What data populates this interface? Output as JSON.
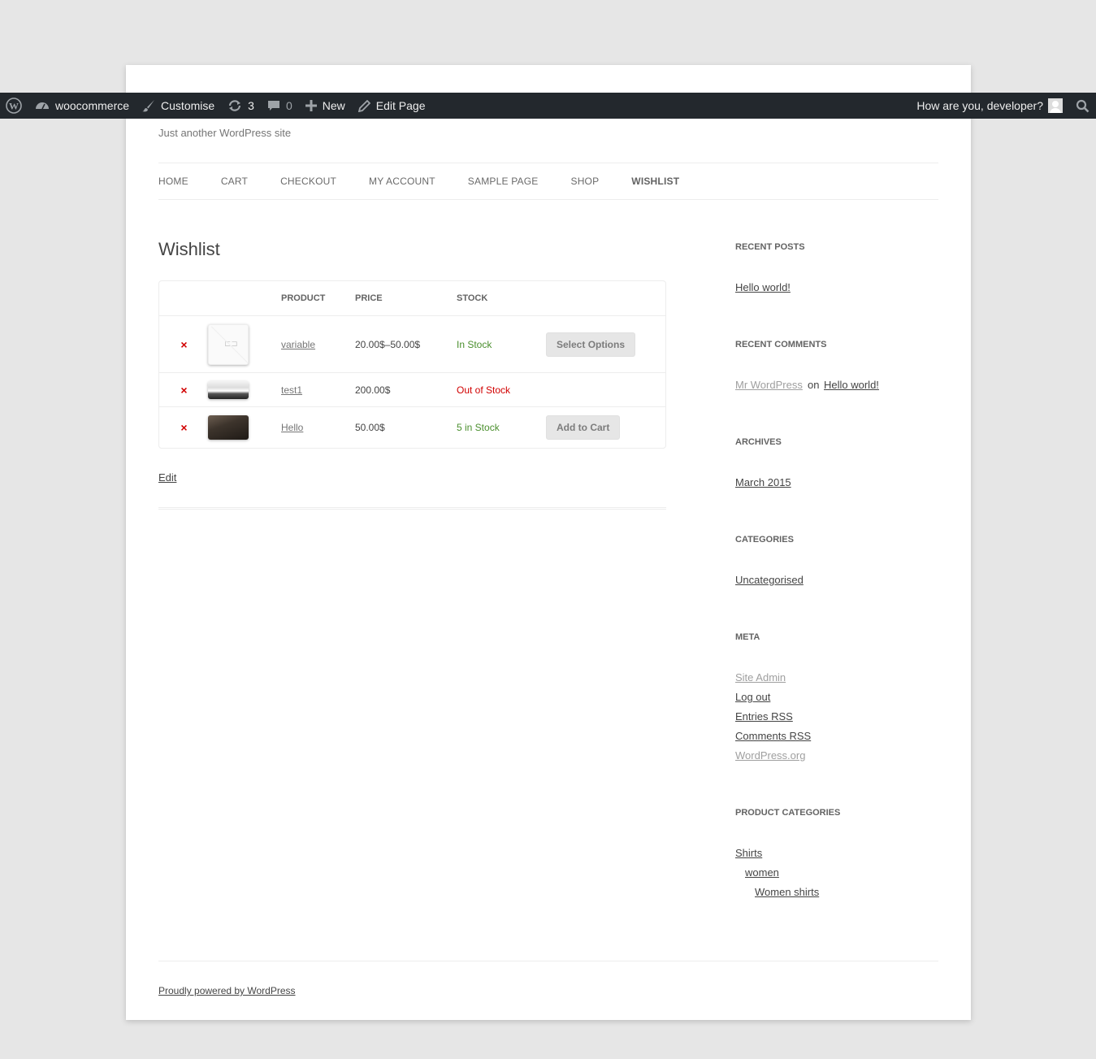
{
  "admin_bar": {
    "site_name": "woocommerce",
    "customise": "Customise",
    "updates_count": "3",
    "comments_count": "0",
    "new_label": "New",
    "edit_page": "Edit Page",
    "greeting": "How are you, developer?"
  },
  "site": {
    "tagline": "Just another WordPress site",
    "nav": [
      "HOME",
      "CART",
      "CHECKOUT",
      "MY ACCOUNT",
      "SAMPLE PAGE",
      "SHOP",
      "WISHLIST"
    ],
    "current_nav": "WISHLIST"
  },
  "page": {
    "title": "Wishlist",
    "table": {
      "headers": {
        "product": "PRODUCT",
        "price": "PRICE",
        "stock": "STOCK"
      },
      "rows": [
        {
          "remove": "×",
          "image": "placeholder",
          "product": "variable",
          "price": "20.00$–50.00$",
          "stock": "In Stock",
          "stock_status": "in",
          "action": "Select Options"
        },
        {
          "remove": "×",
          "image": "office-photo",
          "product": "test1",
          "price": "200.00$",
          "stock": "Out of Stock",
          "stock_status": "out",
          "action": ""
        },
        {
          "remove": "×",
          "image": "dark-photo",
          "product": "Hello",
          "price": "50.00$",
          "stock": "5 in Stock",
          "stock_status": "in",
          "action": "Add to Cart"
        }
      ]
    },
    "edit_link": "Edit"
  },
  "sidebar": {
    "recent_posts": {
      "title": "RECENT POSTS",
      "items": [
        "Hello world!"
      ]
    },
    "recent_comments": {
      "title": "RECENT COMMENTS",
      "author": "Mr WordPress",
      "on": "on",
      "post": "Hello world!"
    },
    "archives": {
      "title": "ARCHIVES",
      "items": [
        "March 2015"
      ]
    },
    "categories": {
      "title": "CATEGORIES",
      "items": [
        "Uncategorised"
      ]
    },
    "meta": {
      "title": "META",
      "items": [
        "Site Admin",
        "Log out",
        "Entries RSS",
        "Comments RSS",
        "WordPress.org"
      ]
    },
    "product_categories": {
      "title": "PRODUCT CATEGORIES",
      "items": [
        "Shirts",
        "women",
        "Women shirts"
      ]
    }
  },
  "footer": {
    "credit": "Proudly powered by WordPress"
  },
  "colors": {
    "admin_bar": "#23282d",
    "in_stock": "#4a8f2d",
    "out_of_stock": "#d10000",
    "remove": "#d10000"
  }
}
